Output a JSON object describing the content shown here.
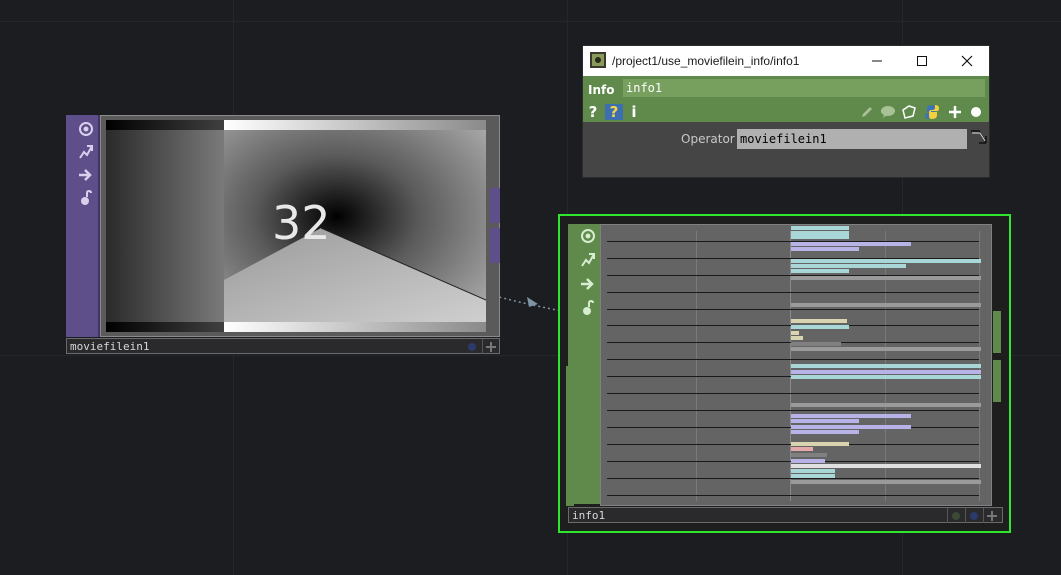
{
  "movie_node": {
    "name": "moviefilein1",
    "frame_number": "32"
  },
  "info_node": {
    "name": "info1"
  },
  "param_window": {
    "title": "/project1/use_moviefilein_info/info1",
    "op_type": "Info",
    "op_name": "info1",
    "toolbar": {
      "help": "?",
      "python_help": "?",
      "info": "i"
    },
    "parameter_label": "Operator",
    "parameter_value": "moviefilein1"
  },
  "colors": {
    "background": "#1c1d21",
    "top_family": "#5e4f8a",
    "dat_family": "#5f8a4c",
    "selected_outline": "#2ee62e"
  },
  "icons": [
    "viewer-icon",
    "bypass-icon",
    "display-icon",
    "lock-icon",
    "close-icon",
    "maximize-icon",
    "minimize-icon",
    "edit-icon",
    "comment-icon",
    "clone-icon",
    "python-icon",
    "add-icon",
    "dot-icon"
  ]
}
